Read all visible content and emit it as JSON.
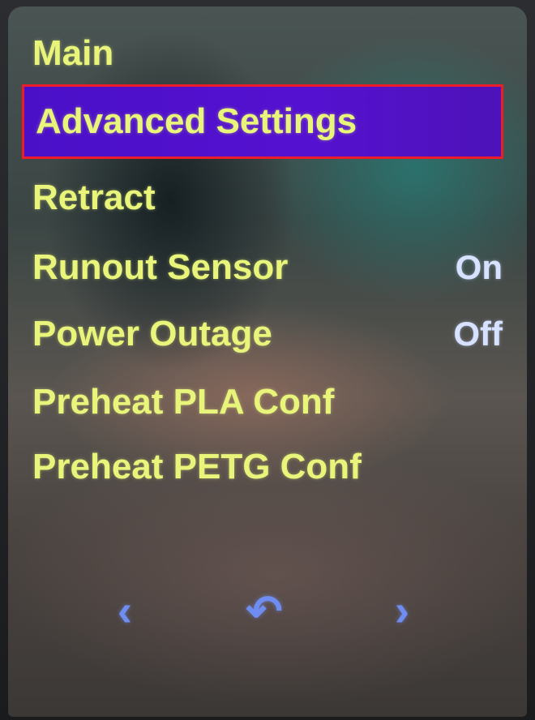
{
  "menu": {
    "items": [
      {
        "label": "Main",
        "value": ""
      },
      {
        "label": "Advanced Settings",
        "value": ""
      },
      {
        "label": "Retract",
        "value": ""
      },
      {
        "label": "Runout Sensor",
        "value": "On"
      },
      {
        "label": "Power Outage",
        "value": "Off"
      },
      {
        "label": "Preheat PLA Conf",
        "value": ""
      },
      {
        "label": "Preheat PETG Conf",
        "value": ""
      }
    ]
  },
  "nav": {
    "prev_icon": "chevron-left-icon",
    "back_icon": "back-arrow-icon",
    "next_icon": "chevron-right-icon",
    "prev_glyph": "‹",
    "back_glyph": "↶",
    "next_glyph": "›"
  },
  "colors": {
    "text": "#e8f57a",
    "value_text": "#d6e2ff",
    "selection_bg": "#5511d0",
    "selection_border": "#ec1c2a",
    "nav_icon": "#6f8df0"
  }
}
